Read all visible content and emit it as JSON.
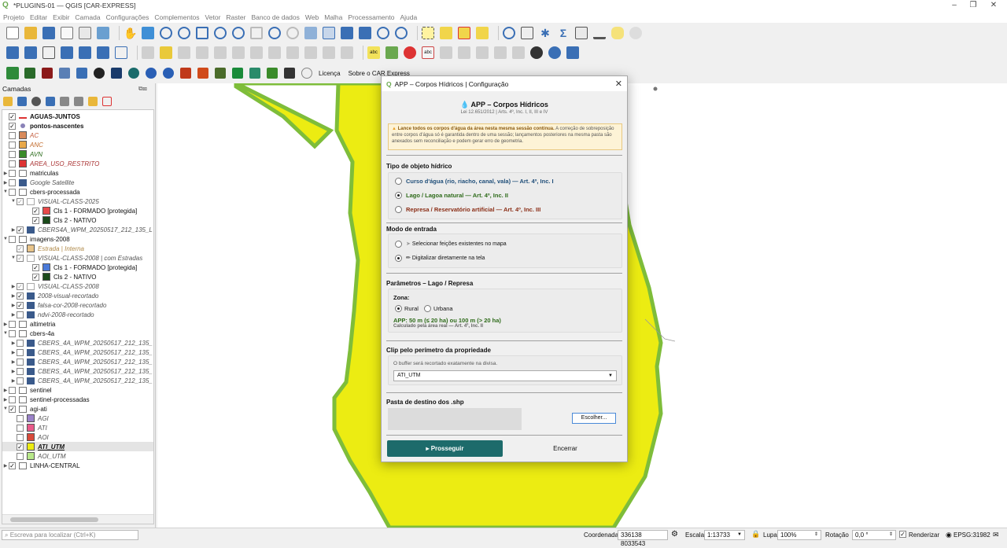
{
  "window": {
    "title": "*PLUGINS-01 — QGIS [CAR-EXPRESS]",
    "menu": [
      "Projeto",
      "Editar",
      "Exibir",
      "Camada",
      "Configurações",
      "Complementos",
      "Vetor",
      "Raster",
      "Banco de dados",
      "Web",
      "Malha",
      "Processamento",
      "Ajuda"
    ]
  },
  "plugins_bar": {
    "licenca": "Licença",
    "sobre": "Sobre o CAR Express"
  },
  "layers_panel": {
    "title": "Camadas",
    "items": [
      {
        "label": "AGUAS-JUNTOS",
        "checked": true,
        "bold": true
      },
      {
        "label": "pontos-nascentes",
        "checked": true,
        "bold": true
      },
      {
        "label": "AC",
        "checked": false
      },
      {
        "label": "ANC",
        "checked": false
      },
      {
        "label": "AVN",
        "checked": false
      },
      {
        "label": "AREA_USO_RESTRITO",
        "checked": false
      },
      {
        "label": "matriculas"
      },
      {
        "label": "Google Satellite"
      },
      {
        "label": "cbers-processada"
      },
      {
        "label": "VISUAL-CLASS-2025"
      },
      {
        "label": "Cls 1 - FORMADO [protegida]"
      },
      {
        "label": "Cls 2 - NATIVO"
      },
      {
        "label": "CBERS4A_WPM_20250517_212_135_L"
      },
      {
        "label": "imagens-2008"
      },
      {
        "label": "Estrada | Interna"
      },
      {
        "label": "VISUAL-CLASS-2008 | com Estradas"
      },
      {
        "label": "Cls 1 - FORMADO [protegida]"
      },
      {
        "label": "Cls 2 - NATIVO"
      },
      {
        "label": "VISUAL-CLASS-2008"
      },
      {
        "label": "2008-visual-recortado"
      },
      {
        "label": "falsa-cor-2008-recortado"
      },
      {
        "label": "ndvi-2008-recortado"
      },
      {
        "label": "altimetria"
      },
      {
        "label": "cbers-4a"
      },
      {
        "label": "CBERS_4A_WPM_20250517_212_135_"
      },
      {
        "label": "CBERS_4A_WPM_20250517_212_135_"
      },
      {
        "label": "CBERS_4A_WPM_20250517_212_135_"
      },
      {
        "label": "CBERS_4A_WPM_20250517_212_135_"
      },
      {
        "label": "CBERS_4A_WPM_20250517_212_135_"
      },
      {
        "label": "sentinel"
      },
      {
        "label": "sentinel-processadas"
      },
      {
        "label": "agi-ati"
      },
      {
        "label": "AGI"
      },
      {
        "label": "ATI"
      },
      {
        "label": "AOI"
      },
      {
        "label": "ATI_UTM"
      },
      {
        "label": "AOI_UTM"
      },
      {
        "label": "LINHA-CENTRAL"
      }
    ]
  },
  "dialog": {
    "window_title": "APP – Corpos Hídricos | Configuração",
    "heading": "APP – Corpos Hídricos",
    "subheading": "Lei 12.651/2012 | Arts. 4º, Inc. I, II, III e IV",
    "warning_bold": "Lance todos os corpos d'água da área nesta mesma sessão contínua.",
    "warning_text": "A correção de sobreposição entre corpos d'água só é garantida dentro de uma sessão; lançamentos posteriores na mesma pasta são anexados sem reconciliação e podem gerar erro de geometria.",
    "tipo_title": "Tipo de objeto hídrico",
    "tipo_options": [
      "Curso d'água  (rio, riacho, canal, vala)  — Art. 4º, Inc. I",
      "Lago / Lagoa natural  — Art. 4º, Inc. II",
      "Represa / Reservatório artificial  — Art. 4º, Inc. III"
    ],
    "tipo_selected": 1,
    "modo_title": "Modo de entrada",
    "modo_options": [
      "Selecionar feições existentes no mapa",
      "Digitalizar diretamente na tela"
    ],
    "modo_selected": 1,
    "param_title": "Parâmetros – Lago / Represa",
    "zona_label": "Zona:",
    "zona_options": [
      "Rural",
      "Urbana"
    ],
    "zona_selected": 0,
    "app_text": "APP: 50 m (≤ 20 ha) ou 100 m (> 20 ha)",
    "app_calc": "Calculado pela área real — Art. 4º, Inc. II",
    "clip_title": "Clip pelo perímetro da propriedade",
    "clip_hint": "O buffer será recortado exatamente na divisa.",
    "clip_layer": "ATI_UTM",
    "dest_title": "Pasta de destino dos .shp",
    "choose_label": "Escolher...",
    "proceed_label": "▸  Prosseguir",
    "close_label": "Encerrar"
  },
  "statusbar": {
    "search_placeholder": "Escreva para localizar (Ctrl+K)",
    "coord_label": "Coordenada",
    "coord_value": "336138  8033543",
    "scale_label": "Escala",
    "scale_value": "1:13733",
    "zoom_label": "Lupa",
    "zoom_value": "100%",
    "rotation_label": "Rotação",
    "rotation_value": "0,0 °",
    "render_label": "Renderizar",
    "crs": "EPSG:31982"
  },
  "colors": {
    "map_fill": "#ecec12",
    "map_border": "#7ebd3a",
    "accent": "#1d6b6b"
  }
}
